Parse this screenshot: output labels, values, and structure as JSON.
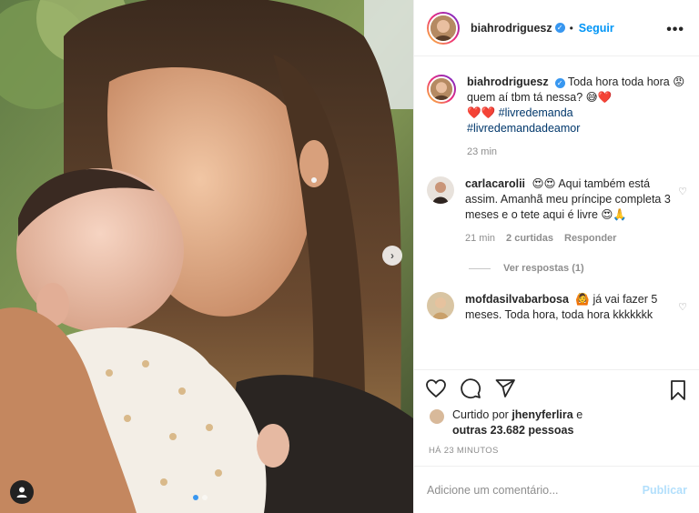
{
  "post": {
    "author": "biahrodriguesz",
    "follow_label": "Seguir",
    "more_icon": "more-horizontal-icon",
    "verified_icon": "verified-badge-icon"
  },
  "caption": {
    "username": "biahrodriguesz",
    "text_1": "Toda hora toda hora 😡 quem aí tbm tá nessa? 😅❤️",
    "text_2": "❤️❤️",
    "hashtag_1": "#livredemanda",
    "hashtag_2": "#livredemandadeamor",
    "time": "23 min"
  },
  "comments": [
    {
      "username": "carlacarolii",
      "text": "😍😍 Aqui também está assim. Amanhã meu príncipe completa 3 meses e o tete aqui é livre 😍🙏",
      "time": "21 min",
      "likes": "2 curtidas",
      "reply": "Responder",
      "view_replies": "Ver respostas (1)"
    },
    {
      "username": "mofdasilvabarbosa",
      "text": "🙆 já vai fazer 5 meses. Toda hora, toda hora kkkkkkk"
    }
  ],
  "liked_by": {
    "prefix": "Curtido por",
    "user": "jhenyferlira",
    "conj": "e",
    "others": "outras 23.682 pessoas"
  },
  "timestamp": "HÁ 23 MINUTOS",
  "comment_box": {
    "placeholder": "Adicione um comentário...",
    "publish_label": "Publicar"
  },
  "colors": {
    "link_blue": "#0095f6",
    "hashtag": "#00376b",
    "muted": "#8e8e8e",
    "publish_disabled": "#b2dffc"
  }
}
